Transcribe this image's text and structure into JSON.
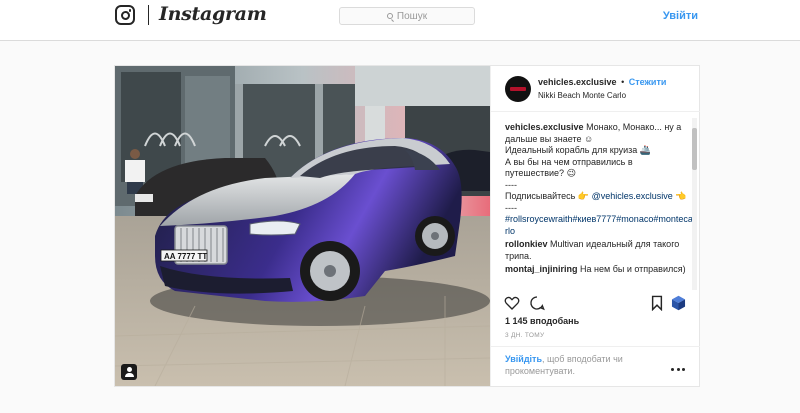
{
  "header": {
    "brand": "Instagram",
    "search_placeholder": "Пошук",
    "login_label": "Увійти"
  },
  "post": {
    "username": "vehicles.exclusive",
    "separator": "•",
    "follow_label": "Стежити",
    "location": "Nikki Beach Monte Carlo",
    "photo_plate": "AA 7777 TT",
    "caption": {
      "username": "vehicles.exclusive",
      "line1": "Монако, Монако... ну а дальше вы знаете ☺",
      "line2": "Идеальный корабль для круиза 🚢",
      "line3": "А вы бы на чем отправились в путешествие? 😉",
      "dash1": "----",
      "subscribe": "Подписывайтесь 👉",
      "subscribe_mention": "@vehicles.exclusive",
      "subscribe_end": "👈",
      "dash2": "----",
      "hashtags": "#rollsroycewraith#киев7777#monaco#montecarlo"
    },
    "comments": [
      {
        "username": "rollonkiev",
        "text": "Multivan идеальный для такого трипа."
      },
      {
        "username": "montaj_injiniring",
        "text": "На нем бы и отправился)"
      }
    ],
    "likes": "1 145 вподобань",
    "time_ago": "3 ДН. ТОМУ",
    "login_prompt_link": "Увійдіть",
    "login_prompt_text": ", щоб вподобати чи прокоментувати."
  },
  "icons": [
    "instagram-glyph-icon",
    "search-icon",
    "heart-icon",
    "comment-icon",
    "bookmark-icon",
    "cube-icon",
    "user-tag-icon",
    "more-icon"
  ]
}
